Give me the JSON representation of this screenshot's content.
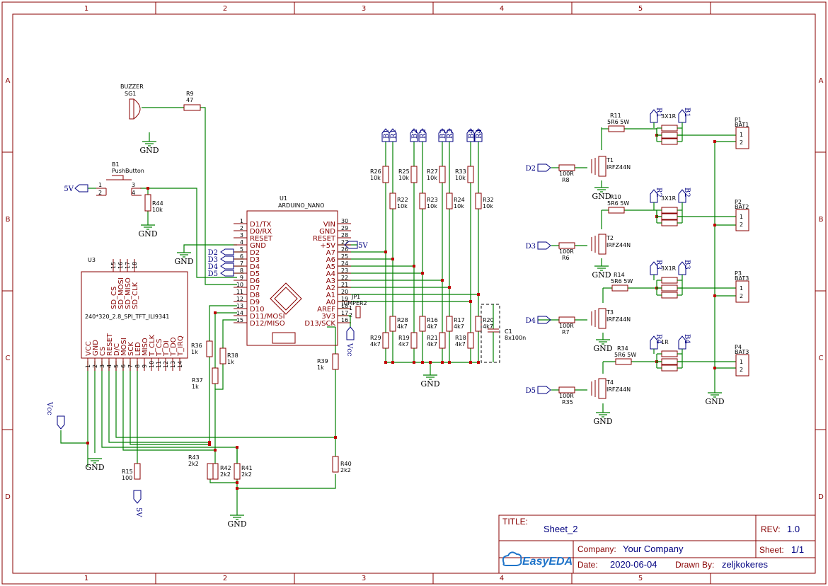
{
  "frame": {
    "cols": [
      "1",
      "2",
      "3",
      "4",
      "5"
    ],
    "rows": [
      "A",
      "B",
      "C",
      "D"
    ]
  },
  "title_block": {
    "title_label": "TITLE:",
    "title": "Sheet_2",
    "rev_label": "REV:",
    "rev": "1.0",
    "company_label": "Company:",
    "company": "Your Company",
    "sheet_label": "Sheet:",
    "sheet": "1/1",
    "date_label": "Date:",
    "date": "2020-06-04",
    "drawn_label": "Drawn By:",
    "drawn": "zeljkokeres",
    "logo": "EasyEDA"
  },
  "parts": {
    "buzzer": {
      "ref": "SG1",
      "name": "BUZZER"
    },
    "r9": {
      "ref": "R9",
      "value": "47"
    },
    "b1": {
      "ref": "B1",
      "name": "PushButton"
    },
    "r44": {
      "ref": "R44",
      "value": "10k"
    },
    "u1": {
      "ref": "U1",
      "name": "ARDUINO_NANO"
    },
    "u3": {
      "ref": "U3",
      "name": "240*320_2.8_SPI_TFT_ILI9341"
    },
    "jp1": {
      "ref": "JP1",
      "name": "JUMPER2"
    },
    "c1": {
      "ref": "C1",
      "value": "8x100n"
    },
    "r15": {
      "ref": "R15",
      "value": "100"
    },
    "r36": {
      "ref": "R36",
      "value": "1k"
    },
    "r37": {
      "ref": "R37",
      "value": "1k"
    },
    "r38": {
      "ref": "R38",
      "value": "1k"
    },
    "r39": {
      "ref": "R39",
      "value": "1k"
    },
    "r40": {
      "ref": "R40",
      "value": "2k2"
    },
    "r41": {
      "ref": "R41",
      "value": "2k2"
    },
    "r42": {
      "ref": "R42",
      "value": "2k2"
    },
    "r43": {
      "ref": "R43",
      "value": "2k2"
    }
  },
  "nano_left_pins": [
    {
      "num": "1",
      "name": "D1/TX"
    },
    {
      "num": "2",
      "name": "D0/RX"
    },
    {
      "num": "3",
      "name": "RESET"
    },
    {
      "num": "4",
      "name": "GND"
    },
    {
      "num": "5",
      "name": "D2"
    },
    {
      "num": "6",
      "name": "D3"
    },
    {
      "num": "7",
      "name": "D4"
    },
    {
      "num": "8",
      "name": "D5"
    },
    {
      "num": "9",
      "name": "D6"
    },
    {
      "num": "10",
      "name": "D7"
    },
    {
      "num": "11",
      "name": "D8"
    },
    {
      "num": "12",
      "name": "D9"
    },
    {
      "num": "13",
      "name": "D10"
    },
    {
      "num": "14",
      "name": "D11/MOSI"
    },
    {
      "num": "15",
      "name": "D12/MISO"
    }
  ],
  "nano_right_pins": [
    {
      "num": "30",
      "name": "VIN"
    },
    {
      "num": "29",
      "name": "GND"
    },
    {
      "num": "28",
      "name": "RESET"
    },
    {
      "num": "27",
      "name": "+5V"
    },
    {
      "num": "26",
      "name": "A7"
    },
    {
      "num": "25",
      "name": "A6"
    },
    {
      "num": "24",
      "name": "A5"
    },
    {
      "num": "23",
      "name": "A4"
    },
    {
      "num": "22",
      "name": "A3"
    },
    {
      "num": "21",
      "name": "A2"
    },
    {
      "num": "20",
      "name": "A1"
    },
    {
      "num": "19",
      "name": "A0"
    },
    {
      "num": "18",
      "name": "AREF"
    },
    {
      "num": "17",
      "name": "3V3"
    },
    {
      "num": "16",
      "name": "D13/SCK"
    }
  ],
  "tft_top_pins": [
    {
      "num": "15",
      "name": "SD_CS"
    },
    {
      "num": "16",
      "name": "SD_MOSI"
    },
    {
      "num": "17",
      "name": "SD_MISO"
    },
    {
      "num": "18",
      "name": "SD_CLK"
    }
  ],
  "tft_bottom_pins": [
    {
      "num": "1",
      "name": "VCC"
    },
    {
      "num": "2",
      "name": "GND"
    },
    {
      "num": "3",
      "name": "CS"
    },
    {
      "num": "4",
      "name": "RESET"
    },
    {
      "num": "5",
      "name": "D/C"
    },
    {
      "num": "6",
      "name": "MOSI"
    },
    {
      "num": "7",
      "name": "SCK"
    },
    {
      "num": "8",
      "name": "LED"
    },
    {
      "num": "9",
      "name": "MISO"
    },
    {
      "num": "10",
      "name": "T_CLK"
    },
    {
      "num": "11",
      "name": "T_CS"
    },
    {
      "num": "12",
      "name": "T_DI"
    },
    {
      "num": "13",
      "name": "T_DO"
    },
    {
      "num": "14",
      "name": "T_IRQ"
    }
  ],
  "divider_top": [
    {
      "ref": "R26",
      "value": "10k"
    },
    {
      "ref": "R25",
      "value": "10k"
    },
    {
      "ref": "R27",
      "value": "10k"
    },
    {
      "ref": "R33",
      "value": "10k"
    }
  ],
  "divider_mid": [
    {
      "ref": "R22",
      "value": "10k"
    },
    {
      "ref": "R23",
      "value": "10k"
    },
    {
      "ref": "R24",
      "value": "10k"
    },
    {
      "ref": "R32",
      "value": "10k"
    }
  ],
  "divider_low": [
    {
      "ref": "R28",
      "value": "4k7"
    },
    {
      "ref": "R16",
      "value": "4k7"
    },
    {
      "ref": "R17",
      "value": "4k7"
    },
    {
      "ref": "R20",
      "value": "4k7"
    }
  ],
  "divider_bot": [
    {
      "ref": "R29",
      "value": "4k7"
    },
    {
      "ref": "R19",
      "value": "4k7"
    },
    {
      "ref": "R21",
      "value": "4k7"
    },
    {
      "ref": "R18",
      "value": "4k7"
    }
  ],
  "divider_ports": [
    "B1",
    "R1",
    "B2",
    "R2",
    "B3",
    "R3",
    "B4",
    "R4"
  ],
  "channels": [
    {
      "gate_port": "D2",
      "rg": "R8",
      "rg_val": "100R",
      "t": "T1",
      "t_name": "IRFZ44N",
      "rl": "R11",
      "rl_val": "5R6 5W",
      "mid": "3X1R",
      "pa": "R1",
      "pb": "B1",
      "conn": "P1",
      "conn_name": "BAT1"
    },
    {
      "gate_port": "D3",
      "rg": "R6",
      "rg_val": "100R",
      "t": "T2",
      "t_name": "IRFZ44N",
      "rl": "R10",
      "rl_val": "5R6 5W",
      "mid": "3X1R",
      "pa": "R2",
      "pb": "B2",
      "conn": "P2",
      "conn_name": "BAT2"
    },
    {
      "gate_port": "D4",
      "rg": "R7",
      "rg_val": "100R",
      "t": "T3",
      "t_name": "IRFZ44N",
      "rl": "R14",
      "rl_val": "5R6 5W",
      "mid": "3X1R",
      "pa": "R3",
      "pb": "B3",
      "conn": "P3",
      "conn_name": "BAT3"
    },
    {
      "gate_port": "D5",
      "rg": "R35",
      "rg_val": "100R",
      "t": "T4",
      "t_name": "IRFZ44N",
      "rl": "R34",
      "rl_val": "5R6 5W",
      "mid": "1R",
      "pa": "R4",
      "pb": "B4",
      "conn": "P4",
      "conn_name": "BAT3"
    }
  ],
  "nets": {
    "gnd": "GND",
    "v5": "5V",
    "vcc": "Vcc",
    "d2": "D2",
    "d3": "D3",
    "d4": "D4",
    "d5": "D5"
  },
  "conn_pins": [
    "1",
    "2"
  ],
  "pb_pins": [
    "1",
    "2",
    "3",
    "4"
  ]
}
